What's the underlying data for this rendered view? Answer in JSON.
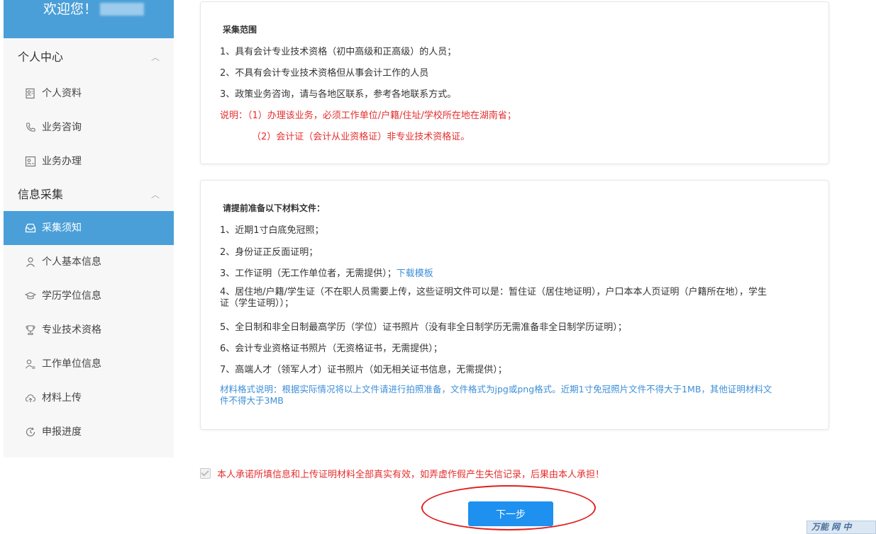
{
  "sidebar": {
    "welcome": "欢迎您！",
    "groups": [
      {
        "title": "个人中心",
        "items": [
          "个人资料",
          "业务咨询",
          "业务办理"
        ]
      },
      {
        "title": "信息采集",
        "items": [
          "采集须知",
          "个人基本信息",
          "学历学位信息",
          "专业技术资格",
          "工作单位信息",
          "材料上传",
          "申报进度"
        ]
      }
    ],
    "active_item": "采集须知"
  },
  "scope_panel": {
    "title": "采集范围",
    "lines": [
      "1、具有会计专业技术资格（初中高级和正高级）的人员；",
      "2、不具有会计专业技术资格但从事会计工作的人员",
      "3、政策业务咨询，请与各地区联系，参考各地联系方式。"
    ],
    "note1": "说明：（1）办理该业务，必须工作单位/户籍/住址/学校所在地在湖南省；",
    "note2": "（2）会计证（会计从业资格证）非专业技术资格证。"
  },
  "materials_panel": {
    "title": "请提前准备以下材料文件：",
    "item1": "1、近期1寸白底免冠照；",
    "item2": "2、身份证正反面证明；",
    "item3": "3、工作证明（无工作单位者，无需提供）；",
    "item3_link": "下载模板",
    "item4": "4、居住地/户籍/学生证（不在职人员需要上传，这些证明文件可以是：暂住证（居住地证明），户口本本人页证明（户籍所在地），学生证（学生证明））；",
    "item5": "5、全日制和非全日制最高学历（学位）证书照片（没有非全日制学历无需准备非全日制学历证明）；",
    "item6": "6、会计专业资格证书照片（无资格证书，无需提供）；",
    "item7": "7、高端人才（领军人才）证书照片（如无相关证书信息，无需提供）；",
    "format_note": "材料格式说明：根据实际情况将以上文件请进行拍照准备，文件格式为jpg或png格式。近期1寸免冠照片文件不得大于1MB，其他证明材料文件不得大于3MB"
  },
  "agreement": {
    "checked": true,
    "text": "本人承诺所填信息和上传证明材料全部真实有效，如弄虚作假产生失信记录，后果由本人承担！"
  },
  "next_button": "下一步",
  "watermark": "万能 网 中",
  "colors": {
    "primary": "#4a9fd8",
    "button": "#1e90f0",
    "warning": "#e52e2e",
    "link": "#3d8fd7"
  }
}
